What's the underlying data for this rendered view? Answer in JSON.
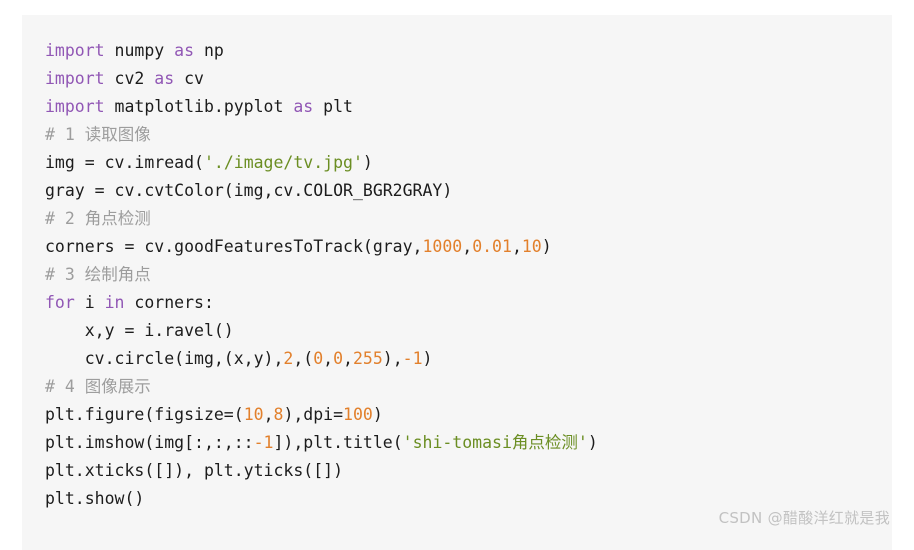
{
  "panel": {
    "background_color": "#f6f6f6",
    "page_background_color": "#ffffff"
  },
  "syntax_colors": {
    "keyword": "#9157b5",
    "number": "#e2802c",
    "string": "#6b8e23",
    "comment": "#9d9d9d",
    "plain": "#1c1c1c"
  },
  "code": {
    "language": "python",
    "lines": [
      {
        "index": 1,
        "text": "import numpy as np",
        "tokens": [
          {
            "t": "import",
            "c": "kw"
          },
          {
            "t": " numpy ",
            "c": "plain"
          },
          {
            "t": "as",
            "c": "kw"
          },
          {
            "t": " np",
            "c": "plain"
          }
        ]
      },
      {
        "index": 2,
        "text": "import cv2 as cv",
        "tokens": [
          {
            "t": "import",
            "c": "kw"
          },
          {
            "t": " cv2 ",
            "c": "plain"
          },
          {
            "t": "as",
            "c": "kw"
          },
          {
            "t": " cv",
            "c": "plain"
          }
        ]
      },
      {
        "index": 3,
        "text": "import matplotlib.pyplot as plt",
        "tokens": [
          {
            "t": "import",
            "c": "kw"
          },
          {
            "t": " matplotlib.pyplot ",
            "c": "plain"
          },
          {
            "t": "as",
            "c": "kw"
          },
          {
            "t": " plt",
            "c": "plain"
          }
        ]
      },
      {
        "index": 4,
        "text": "# 1 读取图像",
        "tokens": [
          {
            "t": "# 1 读取图像",
            "c": "com"
          }
        ]
      },
      {
        "index": 5,
        "text": "img = cv.imread('./image/tv.jpg')",
        "tokens": [
          {
            "t": "img = cv.imread(",
            "c": "plain"
          },
          {
            "t": "'./image/tv.jpg'",
            "c": "str"
          },
          {
            "t": ")",
            "c": "plain"
          }
        ]
      },
      {
        "index": 6,
        "text": "gray = cv.cvtColor(img,cv.COLOR_BGR2GRAY)",
        "tokens": [
          {
            "t": "gray = cv.cvtColor(img,cv.COLOR_BGR2GRAY)",
            "c": "plain"
          }
        ]
      },
      {
        "index": 7,
        "text": "# 2 角点检测",
        "tokens": [
          {
            "t": "# 2 角点检测",
            "c": "com"
          }
        ]
      },
      {
        "index": 8,
        "text": "corners = cv.goodFeaturesToTrack(gray,1000,0.01,10)",
        "tokens": [
          {
            "t": "corners = cv.goodFeaturesToTrack(gray,",
            "c": "plain"
          },
          {
            "t": "1000",
            "c": "num"
          },
          {
            "t": ",",
            "c": "plain"
          },
          {
            "t": "0.01",
            "c": "num"
          },
          {
            "t": ",",
            "c": "plain"
          },
          {
            "t": "10",
            "c": "num"
          },
          {
            "t": ")",
            "c": "plain"
          }
        ]
      },
      {
        "index": 9,
        "text": "# 3 绘制角点",
        "tokens": [
          {
            "t": "# 3 绘制角点",
            "c": "com"
          }
        ]
      },
      {
        "index": 10,
        "text": "for i in corners:",
        "tokens": [
          {
            "t": "for",
            "c": "kw"
          },
          {
            "t": " i ",
            "c": "plain"
          },
          {
            "t": "in",
            "c": "kw"
          },
          {
            "t": " corners:",
            "c": "plain"
          }
        ]
      },
      {
        "index": 11,
        "text": "    x,y = i.ravel()",
        "tokens": [
          {
            "t": "    x,y = i.ravel()",
            "c": "plain"
          }
        ]
      },
      {
        "index": 12,
        "text": "    cv.circle(img,(x,y),2,(0,0,255),-1)",
        "tokens": [
          {
            "t": "    cv.circle(img,(x,y),",
            "c": "plain"
          },
          {
            "t": "2",
            "c": "num"
          },
          {
            "t": ",(",
            "c": "plain"
          },
          {
            "t": "0",
            "c": "num"
          },
          {
            "t": ",",
            "c": "plain"
          },
          {
            "t": "0",
            "c": "num"
          },
          {
            "t": ",",
            "c": "plain"
          },
          {
            "t": "255",
            "c": "num"
          },
          {
            "t": "),",
            "c": "plain"
          },
          {
            "t": "-1",
            "c": "num"
          },
          {
            "t": ")",
            "c": "plain"
          }
        ]
      },
      {
        "index": 13,
        "text": "# 4 图像展示",
        "tokens": [
          {
            "t": "# 4 图像展示",
            "c": "com"
          }
        ]
      },
      {
        "index": 14,
        "text": "plt.figure(figsize=(10,8),dpi=100)",
        "tokens": [
          {
            "t": "plt.figure(figsize=(",
            "c": "plain"
          },
          {
            "t": "10",
            "c": "num"
          },
          {
            "t": ",",
            "c": "plain"
          },
          {
            "t": "8",
            "c": "num"
          },
          {
            "t": "),dpi=",
            "c": "plain"
          },
          {
            "t": "100",
            "c": "num"
          },
          {
            "t": ")",
            "c": "plain"
          }
        ]
      },
      {
        "index": 15,
        "text": "plt.imshow(img[:,:,::-1]),plt.title('shi-tomasi角点检测')",
        "tokens": [
          {
            "t": "plt.imshow(img[:,:,::",
            "c": "plain"
          },
          {
            "t": "-1",
            "c": "num"
          },
          {
            "t": "]),plt.title(",
            "c": "plain"
          },
          {
            "t": "'shi-tomasi角点检测'",
            "c": "str"
          },
          {
            "t": ")",
            "c": "plain"
          }
        ]
      },
      {
        "index": 16,
        "text": "plt.xticks([]), plt.yticks([])",
        "tokens": [
          {
            "t": "plt.xticks([]), plt.yticks([])",
            "c": "plain"
          }
        ]
      },
      {
        "index": 17,
        "text": "plt.show()",
        "tokens": [
          {
            "t": "plt.show()",
            "c": "plain"
          }
        ]
      }
    ]
  },
  "watermark": {
    "text": "CSDN @醋酸洋红就是我",
    "color": "#c2c2c2"
  }
}
